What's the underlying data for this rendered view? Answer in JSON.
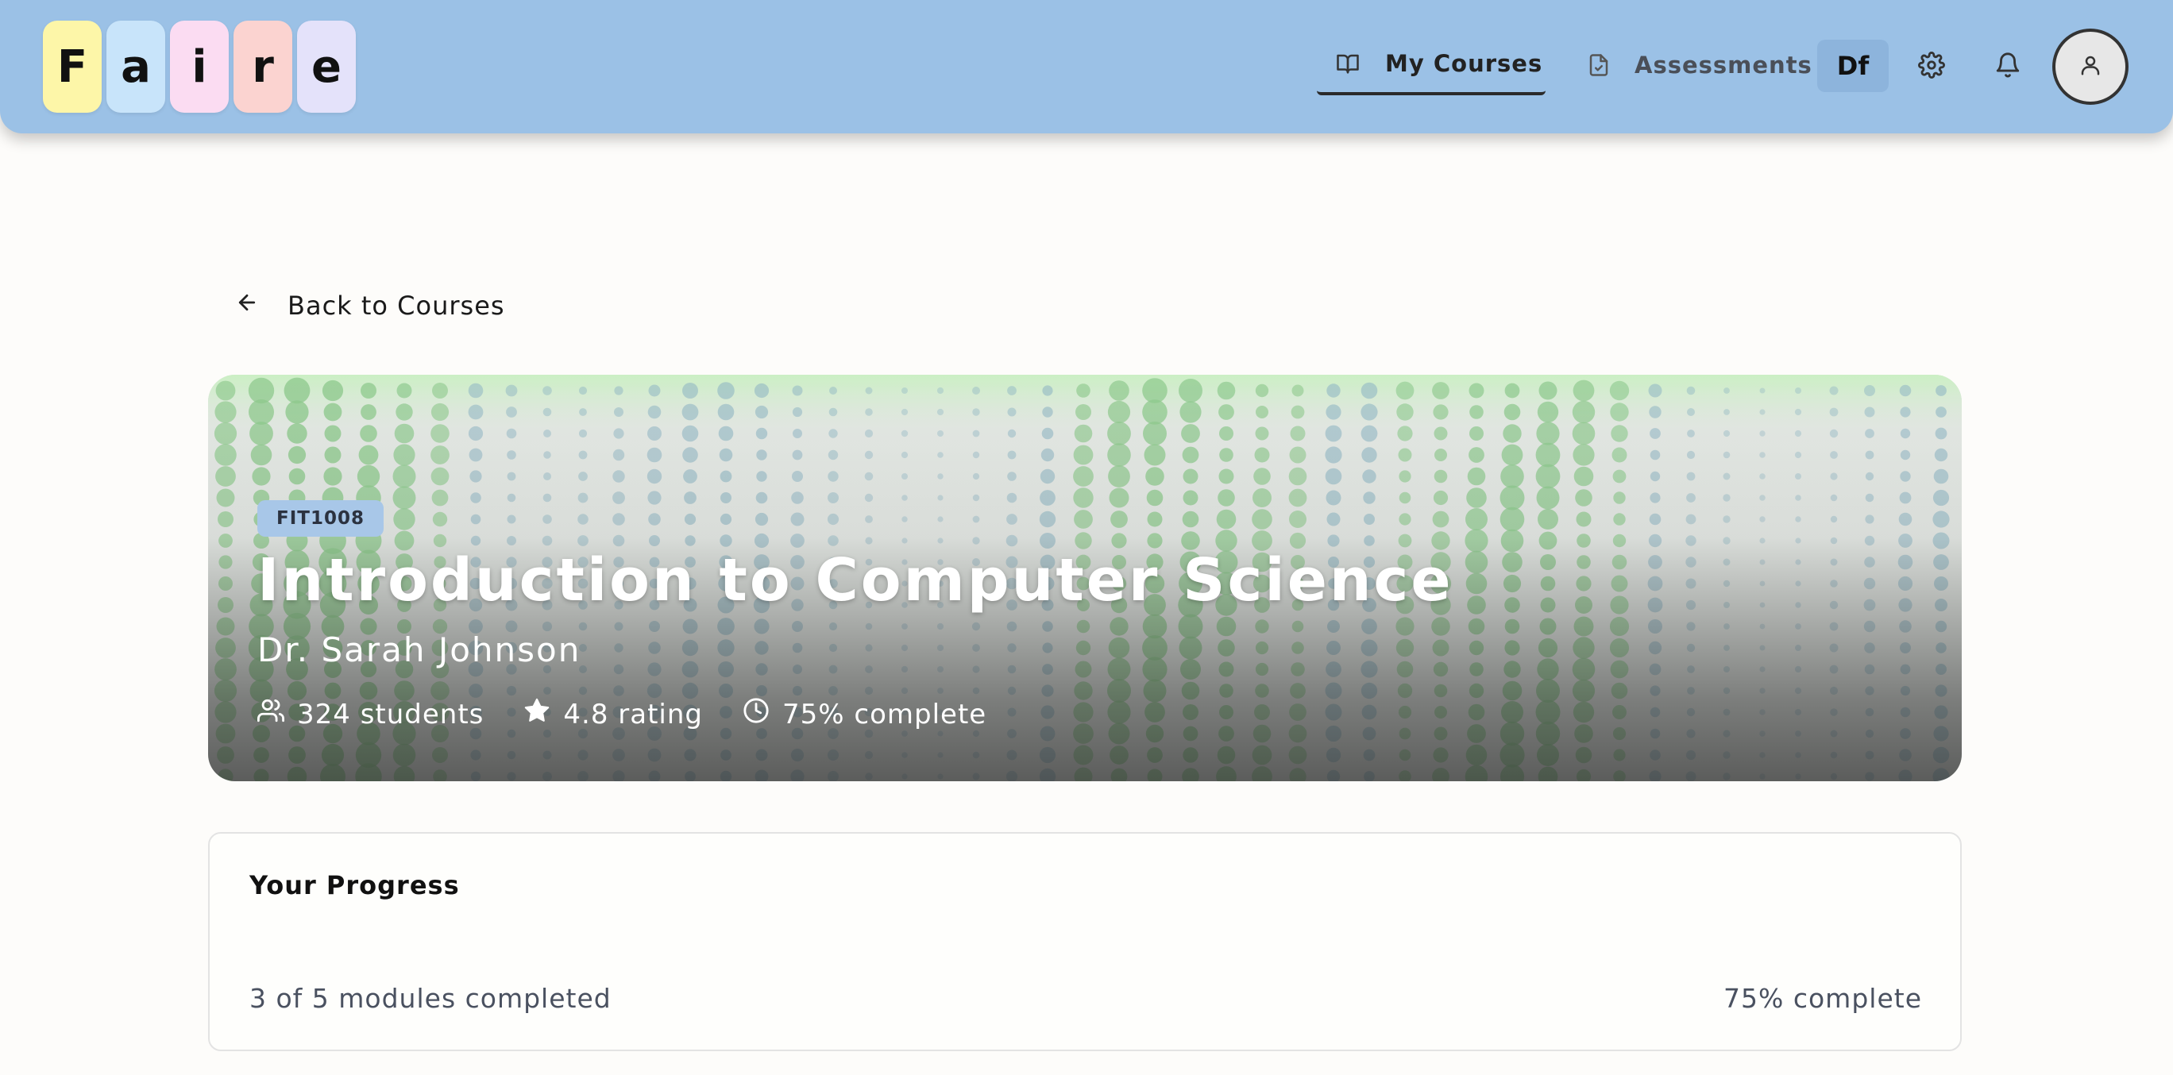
{
  "header": {
    "logo_letters": [
      {
        "char": "F",
        "color": "#fdf6a8"
      },
      {
        "char": "a",
        "color": "#c8e4fa"
      },
      {
        "char": "i",
        "color": "#fbdcf2"
      },
      {
        "char": "r",
        "color": "#fbd3d0"
      },
      {
        "char": "e",
        "color": "#e4e2fa"
      }
    ],
    "nav": {
      "my_courses": "My Courses",
      "assessments": "Assessments"
    },
    "df_label": "Df",
    "icons": {
      "my_courses": "book-open-icon",
      "assessments": "file-check-icon",
      "settings": "gear-icon",
      "notifications": "bell-icon",
      "avatar": "user-icon"
    }
  },
  "back_link": "Back to Courses",
  "course": {
    "code": "FIT1008",
    "title": "Introduction to Computer Science",
    "instructor": "Dr. Sarah Johnson",
    "stats": {
      "students": "324 students",
      "rating": "4.8 rating",
      "completion": "75% complete"
    }
  },
  "progress": {
    "title": "Your Progress",
    "modules_text": "3 of 5 modules completed",
    "percent_text": "75% complete"
  },
  "colors": {
    "header_bg": "#9bc1e6",
    "page_bg": "#fdfcfa",
    "badge_bg": "#a8c7e8"
  }
}
